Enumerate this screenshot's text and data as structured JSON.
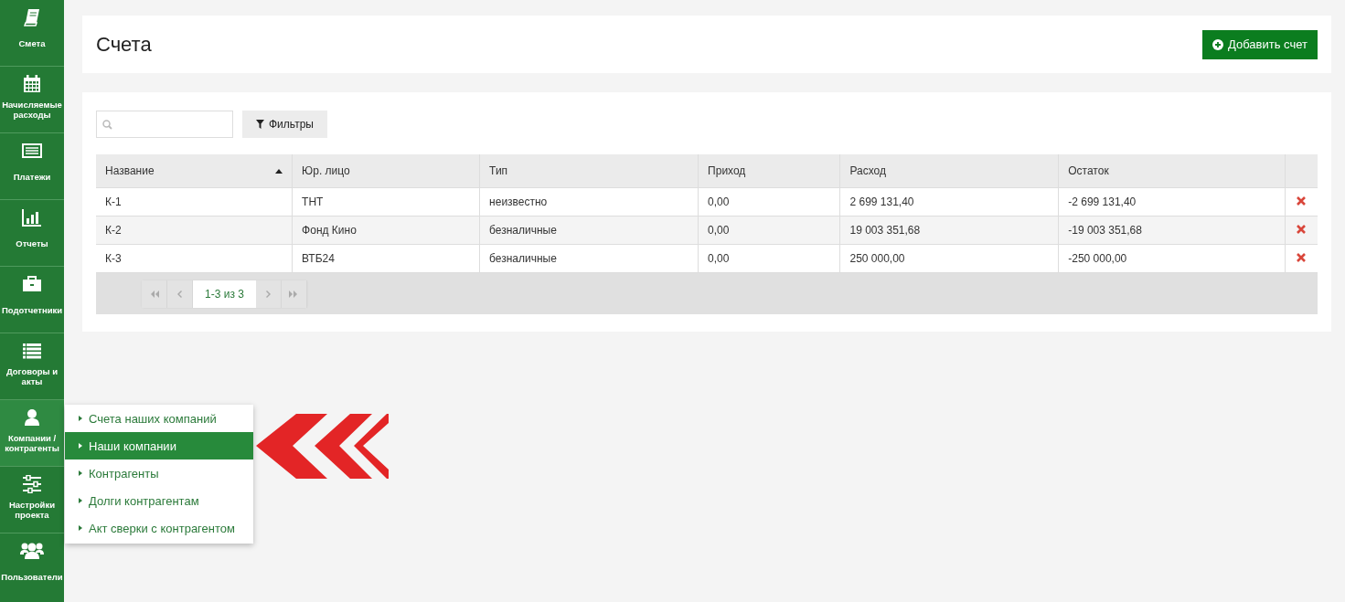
{
  "sidebar": {
    "items": [
      {
        "label": "Смета",
        "selected": false
      },
      {
        "label": "Начисляемые расходы",
        "selected": false
      },
      {
        "label": "Платежи",
        "selected": false
      },
      {
        "label": "Отчеты",
        "selected": false
      },
      {
        "label": "Подотчетники",
        "selected": false
      },
      {
        "label": "Договоры и акты",
        "selected": false
      },
      {
        "label": "Компании / контрагенты",
        "selected": true
      },
      {
        "label": "Настройки проекта",
        "selected": false
      },
      {
        "label": "Пользователи",
        "selected": false
      }
    ]
  },
  "header": {
    "title": "Счета",
    "add_button": "Добавить счет"
  },
  "toolbar": {
    "filter_button": "Фильтры"
  },
  "table": {
    "columns": [
      {
        "label": "Название",
        "sorted": true
      },
      {
        "label": "Юр. лицо"
      },
      {
        "label": "Тип"
      },
      {
        "label": "Приход"
      },
      {
        "label": "Расход"
      },
      {
        "label": "Остаток"
      }
    ],
    "rows": [
      [
        "К-1",
        "ТНТ",
        "неизвестно",
        "0,00",
        "2 699 131,40",
        "-2 699 131,40"
      ],
      [
        "К-2",
        "Фонд Кино",
        "безналичные",
        "0,00",
        "19 003 351,68",
        "-19 003 351,68"
      ],
      [
        "К-3",
        "ВТБ24",
        "безналичные",
        "0,00",
        "250 000,00",
        "-250 000,00"
      ]
    ],
    "pagination": {
      "range": "1-3 из 3"
    }
  },
  "submenu": {
    "items": [
      {
        "label": "Счета наших компаний",
        "selected": false
      },
      {
        "label": "Наши компании",
        "selected": true
      },
      {
        "label": "Контрагенты",
        "selected": false
      },
      {
        "label": "Долги контрагентам",
        "selected": false
      },
      {
        "label": "Акт сверки с контрагентом",
        "selected": false
      }
    ]
  }
}
